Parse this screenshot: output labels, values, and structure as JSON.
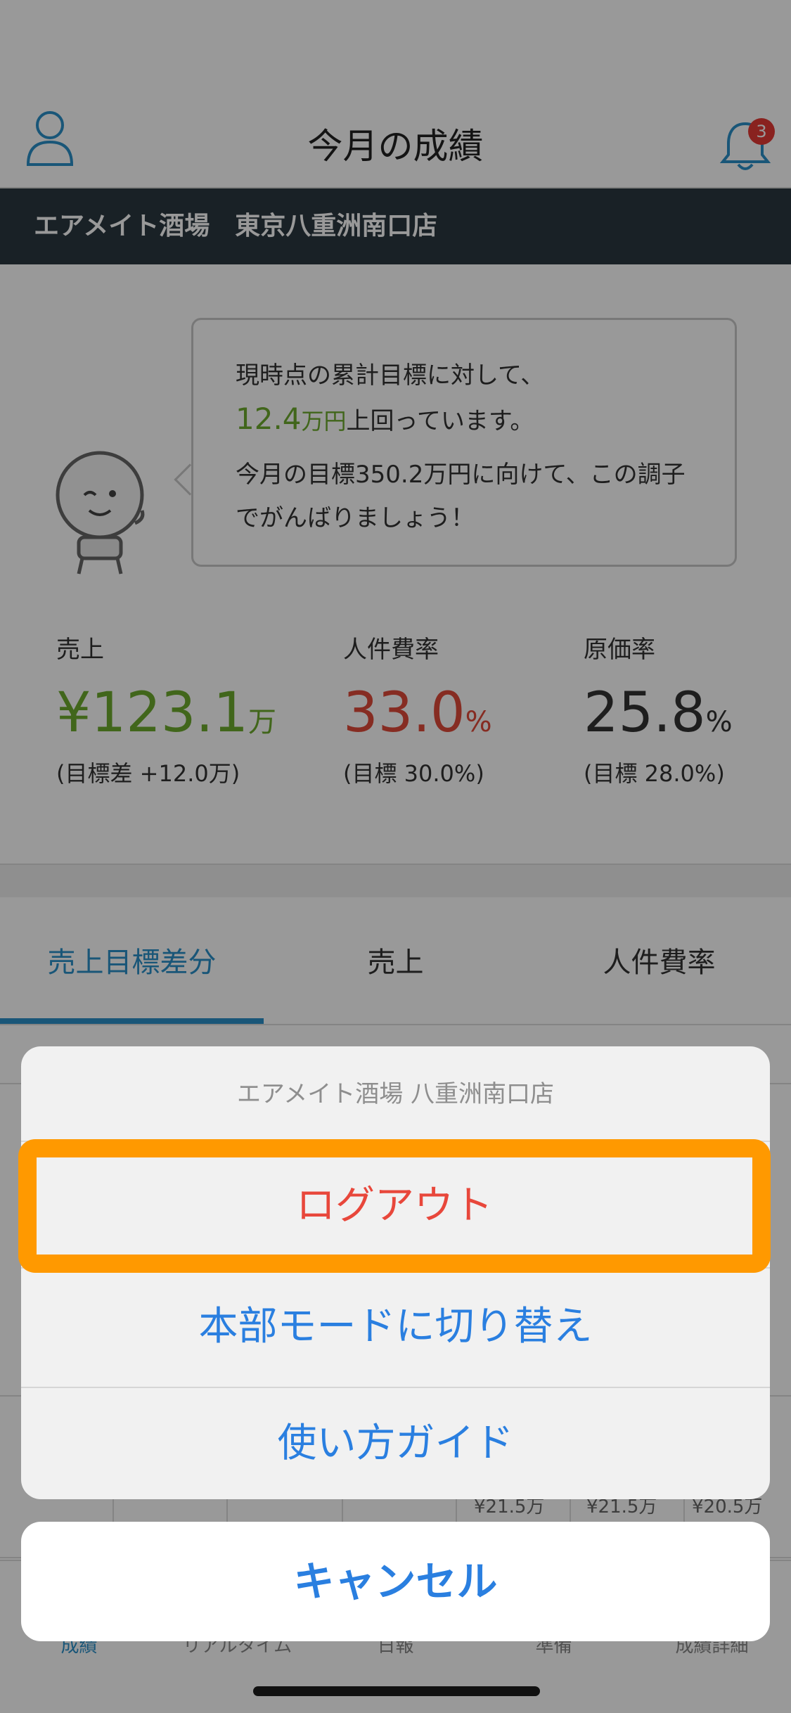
{
  "header": {
    "title": "今月の成績",
    "notification_count": "3",
    "accent_color": "#2a8fc9"
  },
  "store_bar": {
    "store_name": "エアメイト酒場　東京八重洲南口店"
  },
  "message": {
    "line1": "現時点の累計目標に対して、",
    "amount": "12.4",
    "amount_unit": "万円",
    "line2_suffix": "上回っています。",
    "line3": "今月の目標350.2万円に向けて、この調子でがんばりましょう！"
  },
  "metrics": [
    {
      "label": "売上",
      "prefix": "¥",
      "value": "123.1",
      "unit": "万",
      "sub": "(目標差 +12.0万)",
      "color": "#6dab2d"
    },
    {
      "label": "人件費率",
      "prefix": "",
      "value": "33.0",
      "unit": "%",
      "sub": "(目標 30.0%)",
      "color": "#e04a3a"
    },
    {
      "label": "原価率",
      "prefix": "",
      "value": "25.8",
      "unit": "%",
      "sub": "(目標 28.0%)",
      "color": "#333333"
    }
  ],
  "tabs": [
    {
      "label": "売上目標差分",
      "active": true
    },
    {
      "label": "売上",
      "active": false
    },
    {
      "label": "人件費率",
      "active": false
    }
  ],
  "table_fragments": {
    "amounts": [
      "¥21.5万",
      "¥21.5万",
      "¥20.5万"
    ]
  },
  "tabbar": [
    {
      "label": "成績",
      "active": true
    },
    {
      "label": "リアルタイム",
      "active": false
    },
    {
      "label": "日報",
      "active": false
    },
    {
      "label": "準備",
      "active": false
    },
    {
      "label": "成績詳細",
      "active": false
    }
  ],
  "action_sheet": {
    "title": "エアメイト酒場 八重洲南口店",
    "logout": "ログアウト",
    "switch_mode": "本部モードに切り替え",
    "guide": "使い方ガイド",
    "cancel": "キャンセル",
    "highlight_color": "#ff9900"
  }
}
